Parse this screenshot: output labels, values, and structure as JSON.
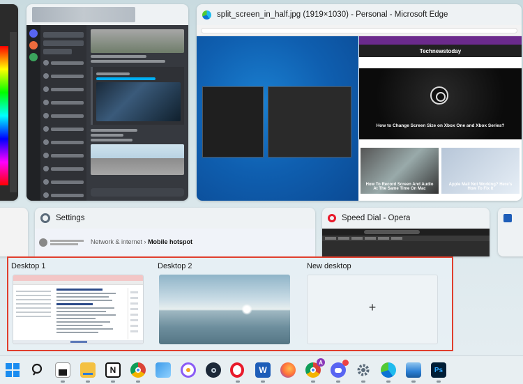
{
  "windows": {
    "edge_title": "split_screen_in_half.jpg (1919×1030) - Personal - Microsoft Edge",
    "settings_title": "Settings",
    "settings_breadcrumb_parent": "Network & internet",
    "settings_breadcrumb_sep": "›",
    "settings_breadcrumb_current": "Mobile hotspot",
    "opera_title": "Speed Dial - Opera"
  },
  "edge_content": {
    "site_name": "Technewstoday",
    "hero_title": "How to Change Screen Size on Xbox One and Xbox Series?",
    "card1_title": "How To Record Screen And Audio At The Same Time On Mac",
    "card2_title": "Apple Mail Not Working? Here's How To Fix It"
  },
  "desktops": {
    "items": [
      {
        "label": "Desktop 1"
      },
      {
        "label": "Desktop 2"
      }
    ],
    "new_label": "New desktop",
    "new_plus": "+"
  },
  "taskbar": {
    "apps": [
      {
        "name": "start",
        "color": "#1a8cf0"
      },
      {
        "name": "search",
        "color": "#1a1a1a"
      },
      {
        "name": "task-view",
        "color": "#1a1a1a"
      },
      {
        "name": "file-explorer",
        "color": "#f4c142"
      },
      {
        "name": "notion",
        "color": "#111111"
      },
      {
        "name": "chrome",
        "color": "#db4437"
      },
      {
        "name": "photos",
        "color": "#3d9be9"
      },
      {
        "name": "brave-vpn",
        "color": "#8a5cf5"
      },
      {
        "name": "steam",
        "color": "#1b2838"
      },
      {
        "name": "opera",
        "color": "#e81a2b"
      },
      {
        "name": "word",
        "color": "#1d5db8"
      },
      {
        "name": "firefox",
        "color": "#ff7139"
      },
      {
        "name": "chrome-profile",
        "color": "#4285f4"
      },
      {
        "name": "discord",
        "color": "#5865f2"
      },
      {
        "name": "settings",
        "color": "#5b6b7a"
      },
      {
        "name": "edge",
        "color": "#0c74d4"
      },
      {
        "name": "photos-viewer",
        "color": "#2a7fd4"
      },
      {
        "name": "photoshop",
        "color": "#001e36"
      }
    ],
    "chrome_profile_badge": "A"
  }
}
